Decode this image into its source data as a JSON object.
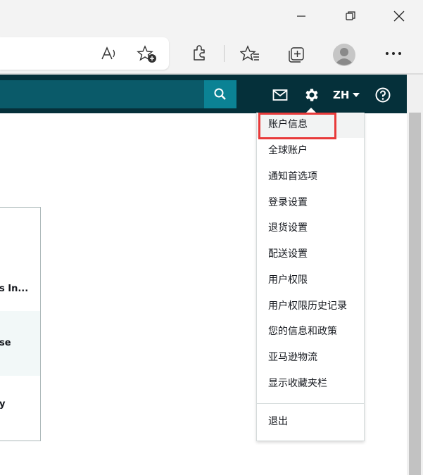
{
  "browser": {
    "window_controls": {
      "minimize": "minimize",
      "maximize": "maximize",
      "close": "close"
    },
    "toolbar_icons": [
      "read-aloud-icon",
      "add-favorite-icon",
      "extensions-icon",
      "favorites-icon",
      "collections-icon",
      "profile-icon",
      "more-icon"
    ]
  },
  "header": {
    "language": "ZH"
  },
  "card": {
    "rows": [
      "s In...",
      "se",
      "y"
    ]
  },
  "menu": {
    "items": [
      {
        "label": "账户信息",
        "highlighted": true
      },
      {
        "label": "全球账户"
      },
      {
        "label": "通知首选项"
      },
      {
        "label": "登录设置"
      },
      {
        "label": "退货设置"
      },
      {
        "label": "配送设置"
      },
      {
        "label": "用户权限"
      },
      {
        "label": "用户权限历史记录"
      },
      {
        "label": "您的信息和政策"
      },
      {
        "label": "亚马逊物流"
      },
      {
        "label": "显示收藏夹栏"
      }
    ],
    "logout": "退出"
  },
  "colors": {
    "header_bg": "#05303a",
    "search_btn": "#0b8294",
    "highlight_border": "#e83a3a"
  }
}
